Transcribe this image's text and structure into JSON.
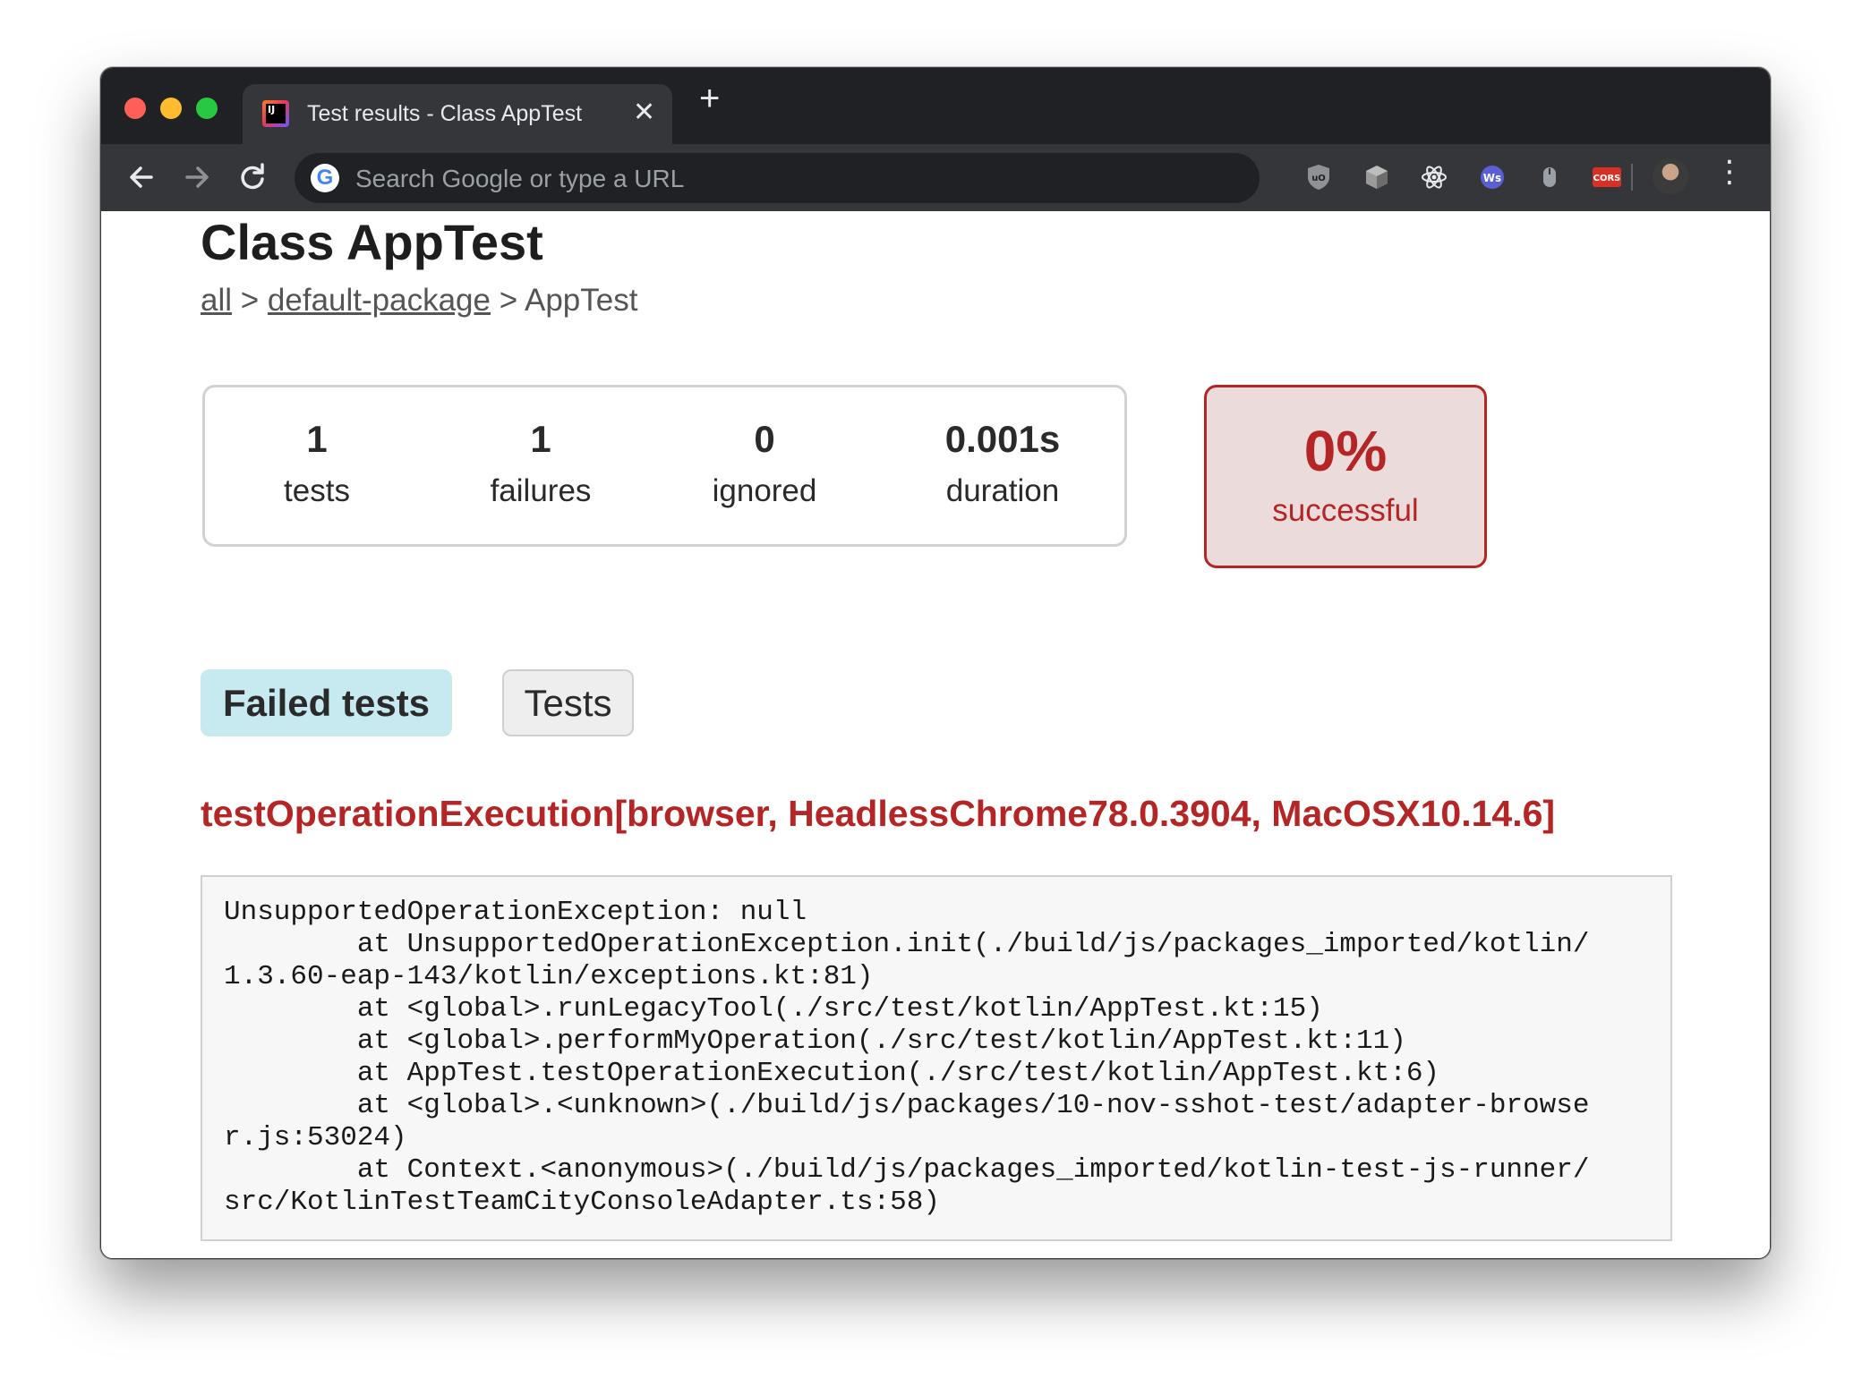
{
  "browser": {
    "tab": {
      "title": "Test results - Class AppTest",
      "close_glyph": "✕"
    },
    "new_tab_glyph": "+",
    "omnibox": {
      "placeholder": "Search Google or type a URL",
      "engine_icon": "google-icon"
    },
    "nav": {
      "back": "back-arrow-icon",
      "forward": "forward-arrow-icon",
      "reload": "reload-icon"
    },
    "extensions": [
      {
        "name": "ublock-icon",
        "label": "uD"
      },
      {
        "name": "cube-extension-icon",
        "label": ""
      },
      {
        "name": "react-devtools-icon",
        "label": ""
      },
      {
        "name": "ws-extension-icon",
        "label": "Ws"
      },
      {
        "name": "mouse-extension-icon",
        "label": ""
      },
      {
        "name": "cors-extension-icon",
        "label": "CORS"
      }
    ],
    "menu_glyph": "⋮"
  },
  "page": {
    "title": "Class AppTest",
    "breadcrumb": {
      "all": "all",
      "sep1": " > ",
      "package": "default-package",
      "sep2": " > ",
      "current": "AppTest"
    },
    "summary": {
      "tests": {
        "value": "1",
        "label": "tests"
      },
      "failures": {
        "value": "1",
        "label": "failures"
      },
      "ignored": {
        "value": "0",
        "label": "ignored"
      },
      "duration": {
        "value": "0.001s",
        "label": "duration"
      }
    },
    "success": {
      "value": "0%",
      "label": "successful"
    },
    "tabs": {
      "failed": "Failed tests",
      "tests": "Tests"
    },
    "failed_test": {
      "name": "testOperationExecution[browser, HeadlessChrome78.0.3904, MacOSX10.14.6]",
      "stacktrace": "UnsupportedOperationException: null\n        at UnsupportedOperationException.init(./build/js/packages_imported/kotlin/\n1.3.60-eap-143/kotlin/exceptions.kt:81)\n        at <global>.runLegacyTool(./src/test/kotlin/AppTest.kt:15)\n        at <global>.performMyOperation(./src/test/kotlin/AppTest.kt:11)\n        at AppTest.testOperationExecution(./src/test/kotlin/AppTest.kt:6)\n        at <global>.<unknown>(./build/js/packages/10-nov-sshot-test/adapter-browse\nr.js:53024)\n        at Context.<anonymous>(./build/js/packages_imported/kotlin-test-js-runner/\nsrc/KotlinTestTeamCityConsoleAdapter.ts:58)"
    }
  },
  "colors": {
    "failure": "#b52525",
    "failure_bg": "#ebdbdb",
    "active_tab_bg": "#c6eaf0"
  }
}
